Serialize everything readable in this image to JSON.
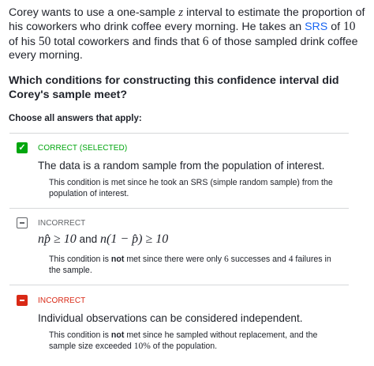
{
  "question": {
    "p1": "Corey wants to use a one-sample ",
    "z": "z",
    "p2": " interval to estimate the proportion of his coworkers who drink coffee every morning. He takes an ",
    "srs_link": "SRS",
    "p3": " of ",
    "n10": "10",
    "p4": " of his ",
    "n50": "50",
    "p5": " total coworkers and finds that ",
    "n6": "6",
    "p6": " of those sampled drink coffee every morning."
  },
  "prompt": "Which conditions for constructing this confidence interval did Corey's sample meet?",
  "instruction": "Choose all answers that apply:",
  "choices": [
    {
      "status": "CORRECT (SELECTED)",
      "status_color": "#00a60e",
      "icon": "check-icon",
      "text": "The data is a random sample from the population of interest.",
      "explanation": "This condition is met since he took an SRS (simple random sample) from the population of interest."
    },
    {
      "status": "INCORRECT",
      "status_color": "#626569",
      "icon": "minus-icon",
      "text_math_1": "np̂ ≥ 10",
      "text_and": " and ",
      "text_math_2": "n(1 − p̂) ≥ 10",
      "expl_1": "This condition is ",
      "expl_not": "not",
      "expl_2": " met since there were only ",
      "expl_n6": "6",
      "expl_3": " successes and ",
      "expl_n4": "4",
      "expl_4": " failures in the sample."
    },
    {
      "status": "INCORRECT",
      "status_color": "#d92916",
      "icon": "minus-icon",
      "text": "Individual observations can be considered independent.",
      "expl_1": "This condition is ",
      "expl_not": "not",
      "expl_2": " met since he sampled without replacement, and the sample size exceeded ",
      "expl_pct": "10%",
      "expl_3": " of the population."
    }
  ]
}
